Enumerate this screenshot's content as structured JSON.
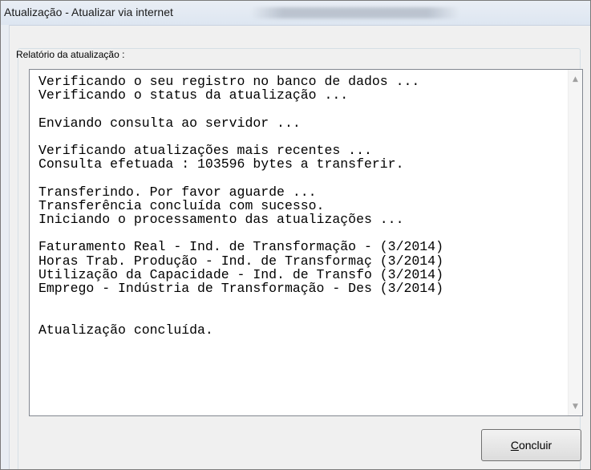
{
  "window": {
    "title": "Atualização - Atualizar via internet"
  },
  "report": {
    "label": "Relatório da atualização :",
    "text": "Verificando o seu registro no banco de dados ...\nVerificando o status da atualização ...\n\nEnviando consulta ao servidor ...\n\nVerificando atualizações mais recentes ...\nConsulta efetuada : 103596 bytes a transferir.\n\nTransferindo. Por favor aguarde ...\nTransferência concluída com sucesso.\nIniciando o processamento das atualizações ...\n\nFaturamento Real - Ind. de Transformação - (3/2014)\nHoras Trab. Produção - Ind. de Transformaç (3/2014)\nUtilização da Capacidade - Ind. de Transfo (3/2014)\nEmprego - Indústria de Transformação - Des (3/2014)\n\n\nAtualização concluída.",
    "scroll_up_icon": "triangle-up",
    "scroll_down_icon": "triangle-down"
  },
  "buttons": {
    "concluir_accel": "C",
    "concluir_rest": "oncluir"
  }
}
